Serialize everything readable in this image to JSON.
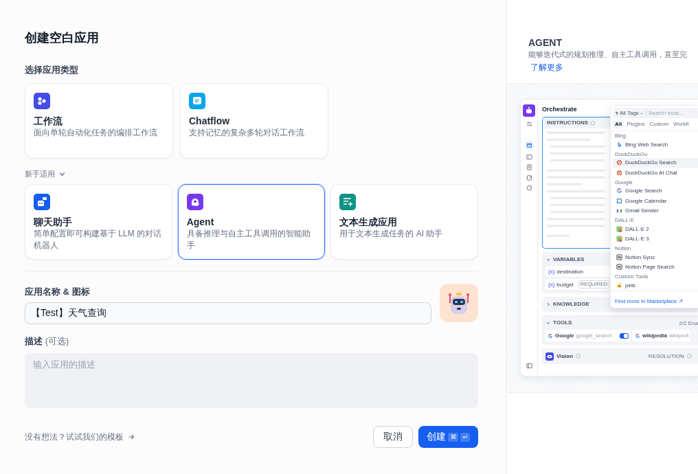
{
  "title": "创建空白应用",
  "type_label": "选择应用类型",
  "primary_types": [
    {
      "kind": "workflow",
      "title": "工作流",
      "description": "面向单轮自动化任务的编排工作流",
      "selected": false
    },
    {
      "kind": "chatflow",
      "title": "Chatflow",
      "description": "支持记忆的复杂多轮对话工作流",
      "selected": false
    }
  ],
  "beginner_toggle": {
    "label": "新手适用",
    "expanded": true
  },
  "beginner_types": [
    {
      "kind": "chatbot",
      "title": "聊天助手",
      "description": "简单配置即可构建基于 LLM 的对话机器人",
      "selected": false
    },
    {
      "kind": "agent",
      "title": "Agent",
      "description": "具备推理与自主工具调用的智能助手",
      "selected": true
    },
    {
      "kind": "completion",
      "title": "文本生成应用",
      "description": "用于文本生成任务的 AI 助手",
      "selected": false
    }
  ],
  "name_field": {
    "label": "应用名称 & 图标",
    "value": "【Test】天气查询"
  },
  "description_field": {
    "label": "描述",
    "optional": "(可选)",
    "placeholder": "输入应用的描述"
  },
  "template_link": "没有想法？试试我们的模板",
  "buttons": {
    "cancel": "取消",
    "create": "创建",
    "shortcut": [
      "⌘",
      "↵"
    ]
  },
  "preview": {
    "title": "AGENT",
    "description": "能够迭代式的规划推理、自主工具调用，直至完",
    "link": "了解更多",
    "screenshot": {
      "heading": "Orchestrate",
      "instructions_label": "INSTRUCTIONS",
      "variables": {
        "label": "VARIABLES",
        "expanded": true,
        "items": [
          {
            "symbol": "{x}",
            "name": "destination"
          },
          {
            "symbol": "{x}",
            "name": "budget",
            "badge": "REQUIRED"
          }
        ]
      },
      "knowledge": {
        "label": "KNOWLEDGE",
        "expanded": false
      },
      "tools": {
        "label": "TOOLS",
        "count": "2/2 Ena",
        "expanded": true,
        "items": [
          {
            "name": "Google",
            "tool_name": "google_search",
            "enabled": true
          },
          {
            "name": "wikipedia",
            "tool_name": "wikipedi"
          }
        ]
      },
      "vision": {
        "label": "Vision",
        "setting": "RESOLUTION"
      },
      "tool_picker": {
        "filter": "All Tags",
        "placeholder": "Search tools...",
        "tabs": [
          {
            "label": "All",
            "selected": true
          },
          {
            "label": "Plugins",
            "selected": false
          },
          {
            "label": "Custom",
            "selected": false
          },
          {
            "label": "Workfl",
            "selected": false
          }
        ],
        "groups": [
          {
            "name": "Bing",
            "tools": [
              {
                "name": "Bing Web Search",
                "highlighted": false
              }
            ]
          },
          {
            "name": "DuckDuckGo",
            "tools": [
              {
                "name": "DuckDuckGo Search",
                "highlighted": true
              },
              {
                "name": "DuckDuckGo AI Chat",
                "highlighted": false
              }
            ]
          },
          {
            "name": "Google",
            "tools": [
              {
                "name": "Google Search",
                "highlighted": false
              },
              {
                "name": "Google Calendar",
                "highlighted": false
              },
              {
                "name": "Gmail Sender",
                "highlighted": false
              }
            ]
          },
          {
            "name": "DALL·E",
            "tools": [
              {
                "name": "DALL·E 2",
                "highlighted": false
              },
              {
                "name": "DALL·E 3",
                "highlighted": false
              }
            ]
          },
          {
            "name": "Notion",
            "tools": [
              {
                "name": "Notion Sync",
                "highlighted": false
              },
              {
                "name": "Notion Page Search",
                "highlighted": false
              }
            ]
          },
          {
            "name": "Custom Tools",
            "tools": [
              {
                "name": "pets",
                "highlighted": false
              }
            ]
          }
        ],
        "footer": "Find more in Marketplace ↗"
      }
    }
  }
}
